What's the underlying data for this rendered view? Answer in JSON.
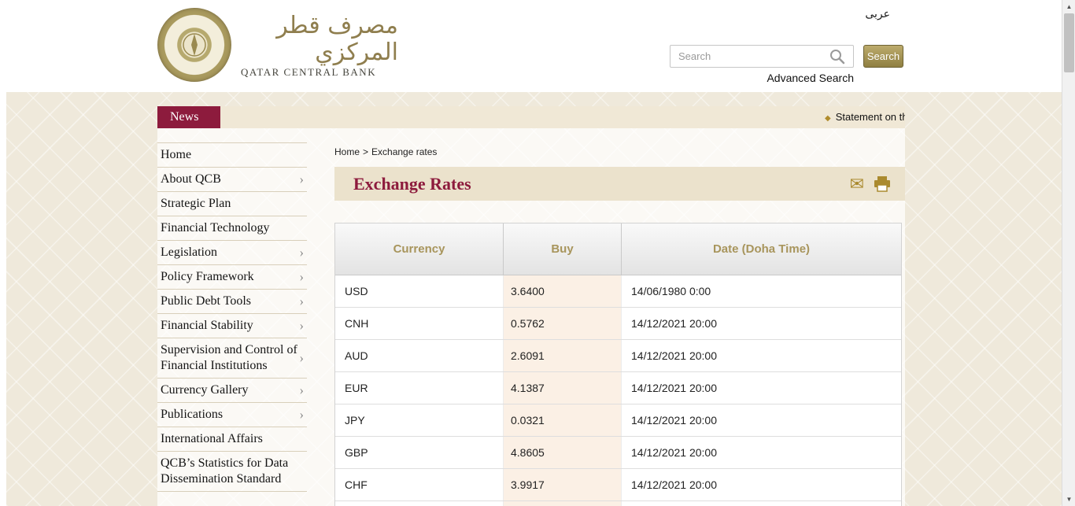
{
  "header": {
    "language_link": "عربى",
    "logo": {
      "arabic_calligraphy": "مصرف قطر المركزي",
      "bank_name": "QATAR CENTRAL BANK"
    },
    "search": {
      "placeholder": "Search",
      "button_label": "Search",
      "advanced_label": "Advanced Search"
    }
  },
  "news_bar": {
    "label": "News",
    "ticker_bullet": "◆",
    "ticker_text": "Statement on th"
  },
  "sidebar": {
    "items": [
      {
        "label": "Home"
      },
      {
        "label": "About QCB"
      },
      {
        "label": "Strategic Plan"
      },
      {
        "label": "Financial Technology"
      },
      {
        "label": "Legislation"
      },
      {
        "label": "Policy Framework"
      },
      {
        "label": "Public Debt Tools"
      },
      {
        "label": "Financial Stability"
      },
      {
        "label": "Supervision and Control of Financial Institutions"
      },
      {
        "label": "Currency Gallery"
      },
      {
        "label": "Publications"
      },
      {
        "label": "International Affairs"
      },
      {
        "label": "QCB’s Statistics for Data Dissemination Standard"
      }
    ]
  },
  "main": {
    "breadcrumb": {
      "home": "Home",
      "separator": ">",
      "current": "Exchange rates"
    },
    "title": "Exchange Rates",
    "table": {
      "headers": {
        "currency": "Currency",
        "buy": "Buy",
        "date": "Date (Doha Time)"
      },
      "rows": [
        {
          "currency": "USD",
          "buy": "3.6400",
          "date": "14/06/1980 0:00"
        },
        {
          "currency": "CNH",
          "buy": "0.5762",
          "date": "14/12/2021 20:00"
        },
        {
          "currency": "AUD",
          "buy": "2.6091",
          "date": "14/12/2021 20:00"
        },
        {
          "currency": "EUR",
          "buy": "4.1387",
          "date": "14/12/2021 20:00"
        },
        {
          "currency": "JPY",
          "buy": "0.0321",
          "date": "14/12/2021 20:00"
        },
        {
          "currency": "GBP",
          "buy": "4.8605",
          "date": "14/12/2021 20:00"
        },
        {
          "currency": "CHF",
          "buy": "3.9917",
          "date": "14/12/2021 20:00"
        }
      ]
    }
  },
  "icons": {
    "chevron": "›",
    "envelope": "✉",
    "scroll_up": "▲",
    "scroll_down": "▼"
  },
  "colors": {
    "maroon": "#8d1b3d",
    "gold": "#a8955c",
    "title_bar_beige": "#ebe2cc",
    "buy_cell": "#fbf0e5",
    "button_olive": "#8f7f41"
  }
}
